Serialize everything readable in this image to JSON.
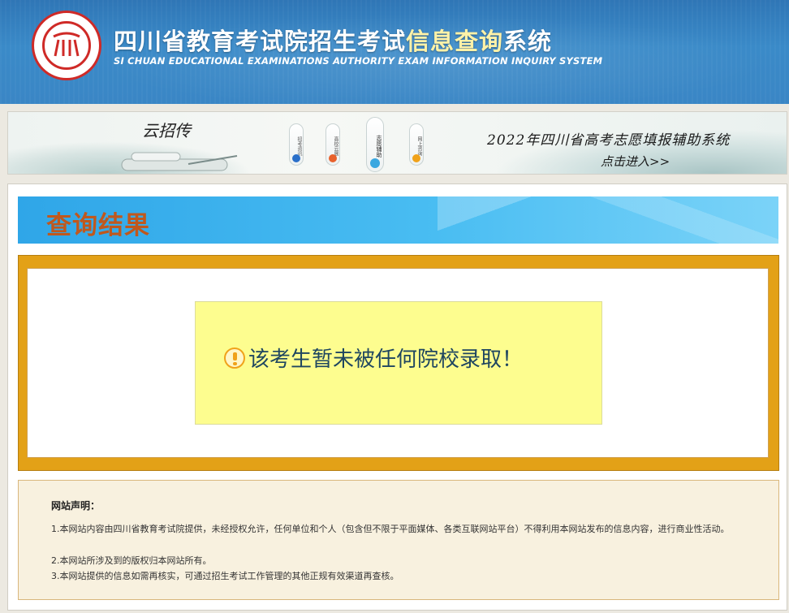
{
  "header": {
    "title_part1": "四川省教育考试院招生考试",
    "title_highlight": "信息查询",
    "title_part2": "系统",
    "subtitle": "SI CHUAN EDUCATIONAL EXAMINATIONS AUTHORITY EXAM INFORMATION INQUIRY SYSTEM",
    "logo_icon": "sceea-seal-logo"
  },
  "banner": {
    "brand": "云招传",
    "pills": [
      {
        "label": "招考资讯",
        "color": "#2a6fc9"
      },
      {
        "label": "高校云展",
        "color": "#e8612c"
      },
      {
        "label": "志愿辅助",
        "color": "#3aa7e0"
      },
      {
        "label": "网上咨询",
        "color": "#f0a21a"
      }
    ],
    "title": "2022年四川省高考志愿填报辅助系统",
    "link": "点击进入>>"
  },
  "result": {
    "section_title": "查询结果",
    "message": "该考生暂未被任何院校录取！",
    "icon": "warning-exclamation-icon"
  },
  "notice": {
    "title": "网站声明：",
    "lines": [
      "1.本网站内容由四川省教育考试院提供，未经授权允许，任何单位和个人（包含但不限于平面媒体、各类互联网站平台）不得利用本网站发布的信息内容，进行商业性活动。",
      "2.本网站所涉及到的版权归本网站所有。",
      "3.本网站提供的信息如需再核实，可通过招生考试工作管理的其他正规有效渠道再查核。"
    ]
  },
  "colors": {
    "header_blue": "#3a86c5",
    "title_orange": "#c0581d",
    "frame_gold": "#e3a117",
    "message_bg": "#fdfd8f"
  }
}
